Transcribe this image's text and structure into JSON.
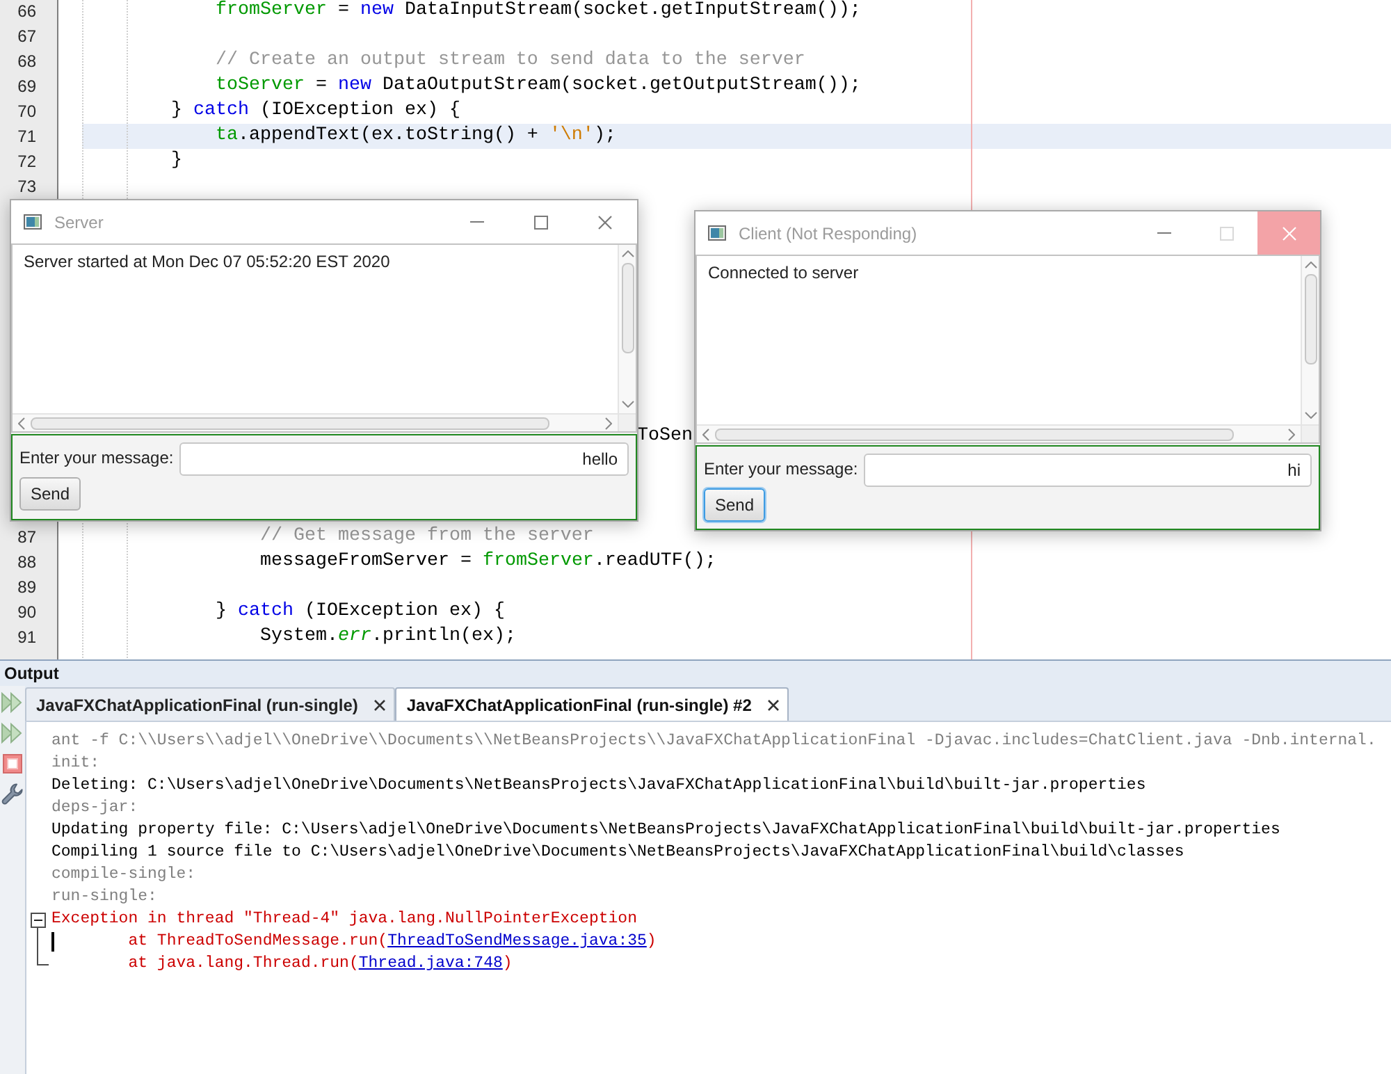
{
  "editor": {
    "lines_top": [
      {
        "number": "66",
        "current_line": false,
        "tokens": [
          {
            "kind": "field",
            "text": "            fromServer"
          },
          {
            "kind": "plain",
            "text": " = "
          },
          {
            "kind": "keyword",
            "text": "new"
          },
          {
            "kind": "plain",
            "text": " DataInputStream(socket.getInputStream());"
          }
        ]
      },
      {
        "number": "67",
        "current_line": false
      },
      {
        "number": "68",
        "current_line": false,
        "tokens": [
          {
            "kind": "comment",
            "text": "            // Create an output stream to send data to the server"
          }
        ]
      },
      {
        "number": "69",
        "current_line": false,
        "tokens": [
          {
            "kind": "field",
            "text": "            toServer"
          },
          {
            "kind": "plain",
            "text": " = "
          },
          {
            "kind": "keyword",
            "text": "new"
          },
          {
            "kind": "plain",
            "text": " DataOutputStream(socket.getOutputStream());"
          }
        ]
      },
      {
        "number": "70",
        "current_line": false,
        "tokens": [
          {
            "kind": "plain",
            "text": "        } "
          },
          {
            "kind": "keyword",
            "text": "catch"
          },
          {
            "kind": "plain",
            "text": " (IOException ex) {"
          }
        ]
      },
      {
        "number": "71",
        "current_line": true,
        "tokens": [
          {
            "kind": "field",
            "text": "            ta"
          },
          {
            "kind": "plain",
            "text": ".appendText(ex.toString() + "
          },
          {
            "kind": "string",
            "text": "'\\n'"
          },
          {
            "kind": "plain",
            "text": ");"
          }
        ]
      },
      {
        "number": "72",
        "current_line": false,
        "tokens": [
          {
            "kind": "plain",
            "text": "        }"
          }
        ]
      },
      {
        "number": "73",
        "current_line": false
      }
    ],
    "covered_fragment": "ToSen",
    "lines_bottom": [
      {
        "number": "87",
        "current_line": false,
        "tokens": [
          {
            "kind": "comment",
            "text": "                // Get message from the server"
          }
        ]
      },
      {
        "number": "88",
        "current_line": false,
        "tokens": [
          {
            "kind": "plain",
            "text": "                messageFromServer = "
          },
          {
            "kind": "field",
            "text": "fromServer"
          },
          {
            "kind": "plain",
            "text": ".readUTF();"
          }
        ]
      },
      {
        "number": "89",
        "current_line": false
      },
      {
        "number": "90",
        "current_line": false,
        "tokens": [
          {
            "kind": "plain",
            "text": "            } "
          },
          {
            "kind": "keyword",
            "text": "catch"
          },
          {
            "kind": "plain",
            "text": " (IOException ex) {"
          }
        ]
      },
      {
        "number": "91",
        "current_line": false,
        "tokens": [
          {
            "kind": "plain",
            "text": "                System."
          },
          {
            "kind": "static_field",
            "text": "err"
          },
          {
            "kind": "plain",
            "text": ".println(ex);"
          }
        ]
      }
    ]
  },
  "windows": [
    {
      "title": "Server",
      "controls": [
        {
          "kind": "minimize",
          "disabled": false,
          "hovered": false
        },
        {
          "kind": "maximize",
          "disabled": false,
          "hovered": false
        },
        {
          "kind": "close",
          "disabled": false,
          "hovered": false
        }
      ],
      "log": [
        "Server started at Mon Dec 07 05:52:20 EST 2020"
      ],
      "prompt_label": "Enter your message:",
      "message_field": {
        "value": "hello"
      },
      "send_button": {
        "label": "Send",
        "focused": false
      }
    },
    {
      "title": "Client (Not Responding)",
      "controls": [
        {
          "kind": "minimize",
          "disabled": false,
          "hovered": false
        },
        {
          "kind": "maximize",
          "disabled": true,
          "hovered": false
        },
        {
          "kind": "close",
          "disabled": false,
          "hovered": true
        }
      ],
      "log": [
        "Connected to server"
      ],
      "prompt_label": "Enter your message:",
      "message_field": {
        "value": "hi"
      },
      "send_button": {
        "label": "Send",
        "focused": true
      }
    }
  ],
  "output": {
    "title": "Output",
    "toolbar": [
      {
        "kind": "run"
      },
      {
        "kind": "run"
      },
      {
        "kind": "stop"
      },
      {
        "kind": "settings"
      }
    ],
    "tabs": [
      {
        "label": "JavaFXChatApplicationFinal (run-single)",
        "selected": false
      },
      {
        "label": "JavaFXChatApplicationFinal (run-single) #2",
        "selected": true
      }
    ],
    "lines": [
      {
        "kind": "info",
        "cursor": false,
        "text": "ant -f C:\\\\Users\\\\adjel\\\\OneDrive\\\\Documents\\\\NetBeansProjects\\\\JavaFXChatApplicationFinal -Djavac.includes=ChatClient.java -Dnb.internal."
      },
      {
        "kind": "info",
        "cursor": false,
        "text": "init:"
      },
      {
        "kind": "plain",
        "cursor": false,
        "text": "Deleting: C:\\Users\\adjel\\OneDrive\\Documents\\NetBeansProjects\\JavaFXChatApplicationFinal\\build\\built-jar.properties"
      },
      {
        "kind": "info",
        "cursor": false,
        "text": "deps-jar:"
      },
      {
        "kind": "plain",
        "cursor": false,
        "text": "Updating property file: C:\\Users\\adjel\\OneDrive\\Documents\\NetBeansProjects\\JavaFXChatApplicationFinal\\build\\built-jar.properties"
      },
      {
        "kind": "plain",
        "cursor": false,
        "text": "Compiling 1 source file to C:\\Users\\adjel\\OneDrive\\Documents\\NetBeansProjects\\JavaFXChatApplicationFinal\\build\\classes"
      },
      {
        "kind": "info",
        "cursor": false,
        "text": "compile-single:"
      },
      {
        "kind": "info",
        "cursor": false,
        "text": "run-single:"
      },
      {
        "kind": "error",
        "cursor": false,
        "text": "Exception in thread \"Thread-4\" java.lang.NullPointerException",
        "expanded": true,
        "children": [
          {
            "kind": "error",
            "cursor": true,
            "tokens": [
              {
                "kind": "text",
                "text": "        at ThreadToSendMessage.run("
              },
              {
                "kind": "link",
                "text": "ThreadToSendMessage.java:35"
              },
              {
                "kind": "text",
                "text": ")"
              }
            ]
          },
          {
            "kind": "error",
            "cursor": false,
            "tokens": [
              {
                "kind": "text",
                "text": "        at java.lang.Thread.run("
              },
              {
                "kind": "link",
                "text": "Thread.java:748"
              },
              {
                "kind": "text",
                "text": ")"
              }
            ]
          }
        ]
      }
    ]
  }
}
